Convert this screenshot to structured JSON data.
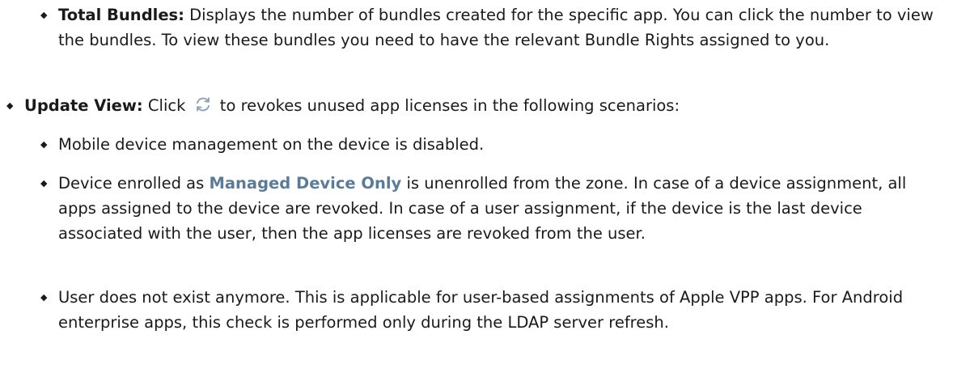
{
  "list": {
    "total_bundles": {
      "term": "Total Bundles:",
      "text": " Displays the number of bundles created for the specific app. You can click the number to view the bundles. To view these bundles you need to have the relevant Bundle Rights assigned to you."
    },
    "update_view": {
      "term": "Update View:",
      "text_before_icon": " Click ",
      "icon": "refresh-icon",
      "text_after_icon": " to revokes unused app licenses in the following scenarios:"
    },
    "scenarios": {
      "mdm_disabled": "Mobile device management on the device is disabled.",
      "unenrolled": {
        "before": "Device enrolled as ",
        "ui_term": "Managed Device Only",
        "after": " is unenrolled from the zone. In case of a device assignment, all apps assigned to the device are revoked. In case of a user assignment, if the device is the last device associated with the user, then the app licenses are revoked from the user."
      },
      "user_missing": "User does not exist anymore. This is applicable for user-based assignments of Apple VPP apps. For Android enterprise apps, this check is performed only during the LDAP server refresh."
    }
  },
  "colors": {
    "text": "#1a1a1a",
    "ui_term": "#5e7b96",
    "icon": "#8fa3b5"
  }
}
